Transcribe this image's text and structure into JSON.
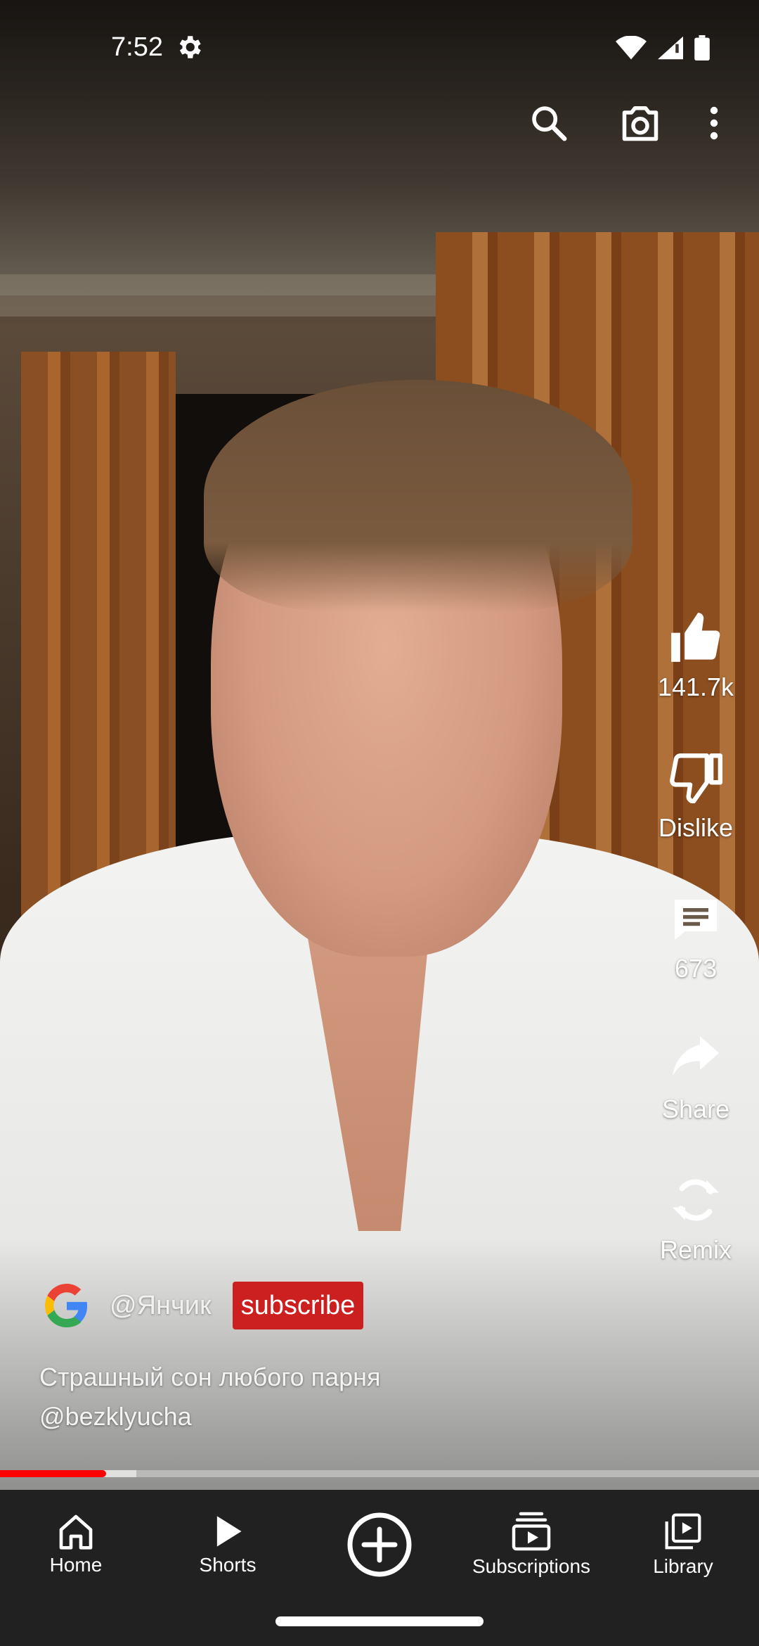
{
  "status_bar": {
    "time": "7:52"
  },
  "side_actions": {
    "like_count": "141.7k",
    "dislike_label": "Dislike",
    "comment_count": "673",
    "share_label": "Share",
    "remix_label": "Remix"
  },
  "channel": {
    "handle": "@Янчик",
    "subscribe_label": "subscribe"
  },
  "caption": {
    "line1": "Страшный сон любого парня",
    "line2": "@bezklyucha"
  },
  "progress": {
    "played_fraction": 0.14,
    "buffered_fraction": 0.18
  },
  "bottom_nav": {
    "home": "Home",
    "shorts": "Shorts",
    "subscriptions": "Subscriptions",
    "library": "Library"
  },
  "colors": {
    "subscribe_bg": "#cc1f1f",
    "progress": "#ff0000",
    "nav_bg": "#212121"
  }
}
